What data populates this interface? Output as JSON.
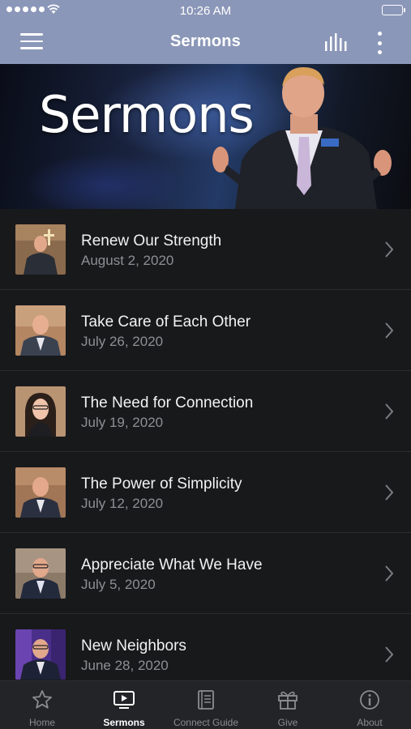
{
  "status_bar": {
    "time": "10:26 AM"
  },
  "nav": {
    "title": "Sermons"
  },
  "banner": {
    "heading": "Sermons"
  },
  "sermons": [
    {
      "title": "Renew Our Strength",
      "date": "August 2, 2020"
    },
    {
      "title": "Take Care of Each Other",
      "date": "July 26, 2020"
    },
    {
      "title": "The Need for Connection",
      "date": "July 19, 2020"
    },
    {
      "title": "The Power of Simplicity",
      "date": "July 12, 2020"
    },
    {
      "title": "Appreciate What We Have",
      "date": "July 5, 2020"
    },
    {
      "title": "New Neighbors",
      "date": "June 28, 2020"
    }
  ],
  "tabs": [
    {
      "label": "Home",
      "icon": "star-icon",
      "active": false
    },
    {
      "label": "Sermons",
      "icon": "tv-icon",
      "active": true
    },
    {
      "label": "Connect Guide",
      "icon": "book-icon",
      "active": false
    },
    {
      "label": "Give",
      "icon": "gift-icon",
      "active": false
    },
    {
      "label": "About",
      "icon": "info-icon",
      "active": false
    }
  ],
  "colors": {
    "nav_bar": "#8b97b8",
    "background": "#18191b",
    "tab_bar": "#232427",
    "active_tab": "#ffffff",
    "inactive_tab": "#8b8c90"
  }
}
